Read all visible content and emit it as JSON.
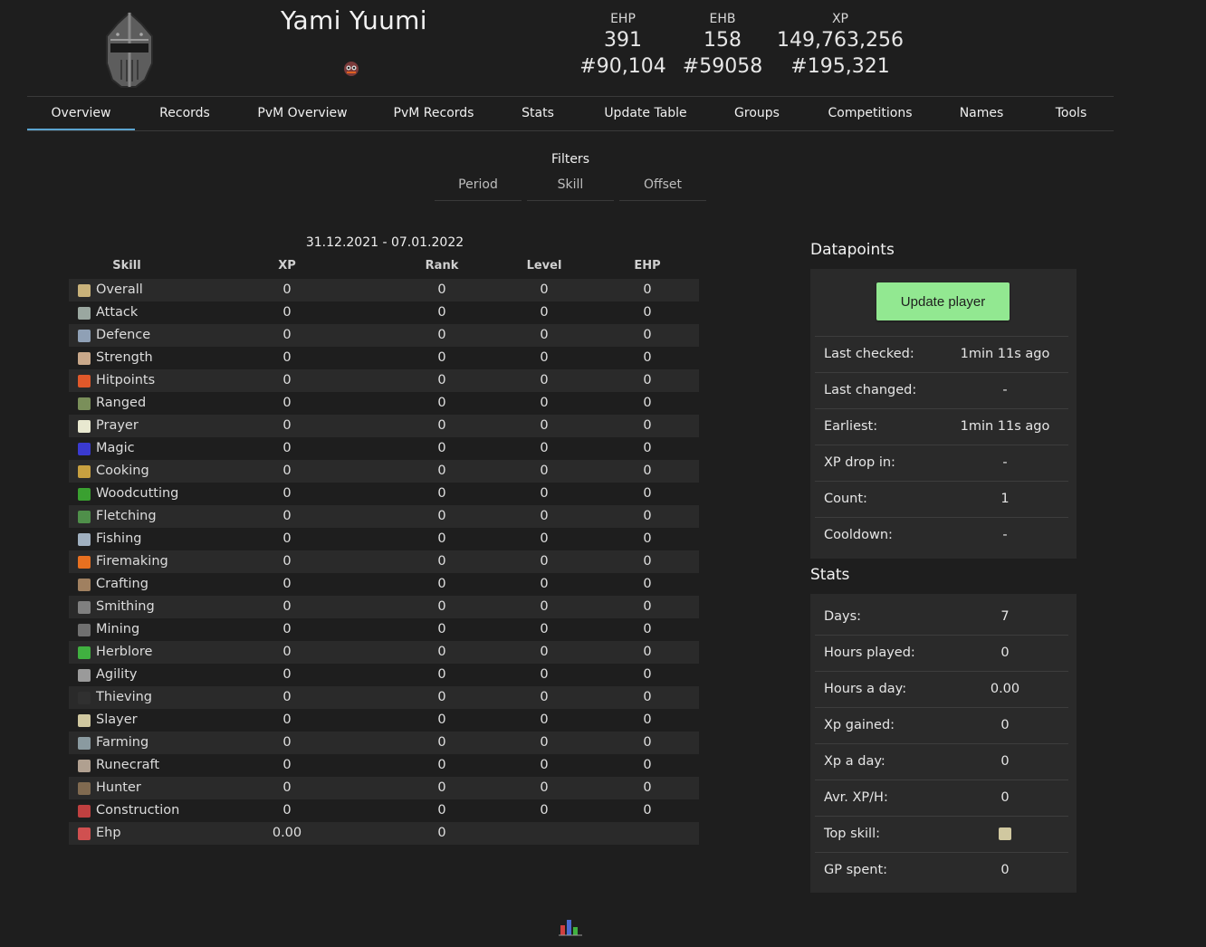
{
  "player": {
    "name": "Yami Yuumi",
    "header_stats": [
      {
        "label": "EHP",
        "value": "391",
        "rank": "#90,104"
      },
      {
        "label": "EHB",
        "value": "158",
        "rank": "#59058"
      },
      {
        "label": "XP",
        "value": "149,763,256",
        "rank": "#195,321"
      }
    ]
  },
  "nav": {
    "items": [
      {
        "label": "Overview",
        "active": true
      },
      {
        "label": "Records"
      },
      {
        "label": "PvM Overview"
      },
      {
        "label": "PvM Records"
      },
      {
        "label": "Stats"
      },
      {
        "label": "Update Table"
      },
      {
        "label": "Groups"
      },
      {
        "label": "Competitions"
      },
      {
        "label": "Names"
      },
      {
        "label": "Tools"
      }
    ]
  },
  "filters": {
    "title": "Filters",
    "tabs": [
      "Period",
      "Skill",
      "Offset"
    ]
  },
  "table": {
    "date_range": "31.12.2021 - 07.01.2022",
    "headers": [
      "Skill",
      "XP",
      "Rank",
      "Level",
      "EHP"
    ],
    "rows": [
      {
        "skill": "Overall",
        "icon": "overall-icon",
        "color": "#c9b27a",
        "xp": "0",
        "rank": "0",
        "level": "0",
        "ehp": "0"
      },
      {
        "skill": "Attack",
        "icon": "attack-icon",
        "color": "#9aa7a0",
        "xp": "0",
        "rank": "0",
        "level": "0",
        "ehp": "0"
      },
      {
        "skill": "Defence",
        "icon": "defence-icon",
        "color": "#8fa0b5",
        "xp": "0",
        "rank": "0",
        "level": "0",
        "ehp": "0"
      },
      {
        "skill": "Strength",
        "icon": "strength-icon",
        "color": "#c9a88a",
        "xp": "0",
        "rank": "0",
        "level": "0",
        "ehp": "0"
      },
      {
        "skill": "Hitpoints",
        "icon": "hitpoints-icon",
        "color": "#e0582a",
        "xp": "0",
        "rank": "0",
        "level": "0",
        "ehp": "0"
      },
      {
        "skill": "Ranged",
        "icon": "ranged-icon",
        "color": "#7a8f5a",
        "xp": "0",
        "rank": "0",
        "level": "0",
        "ehp": "0"
      },
      {
        "skill": "Prayer",
        "icon": "prayer-icon",
        "color": "#e8e8d0",
        "xp": "0",
        "rank": "0",
        "level": "0",
        "ehp": "0"
      },
      {
        "skill": "Magic",
        "icon": "magic-icon",
        "color": "#3a3ad0",
        "xp": "0",
        "rank": "0",
        "level": "0",
        "ehp": "0"
      },
      {
        "skill": "Cooking",
        "icon": "cooking-icon",
        "color": "#c8a040",
        "xp": "0",
        "rank": "0",
        "level": "0",
        "ehp": "0"
      },
      {
        "skill": "Woodcutting",
        "icon": "woodcutting-icon",
        "color": "#3aa030",
        "xp": "0",
        "rank": "0",
        "level": "0",
        "ehp": "0"
      },
      {
        "skill": "Fletching",
        "icon": "fletching-icon",
        "color": "#4f8f4a",
        "xp": "0",
        "rank": "0",
        "level": "0",
        "ehp": "0"
      },
      {
        "skill": "Fishing",
        "icon": "fishing-icon",
        "color": "#a0b0c0",
        "xp": "0",
        "rank": "0",
        "level": "0",
        "ehp": "0"
      },
      {
        "skill": "Firemaking",
        "icon": "firemaking-icon",
        "color": "#e87020",
        "xp": "0",
        "rank": "0",
        "level": "0",
        "ehp": "0"
      },
      {
        "skill": "Crafting",
        "icon": "crafting-icon",
        "color": "#a08060",
        "xp": "0",
        "rank": "0",
        "level": "0",
        "ehp": "0"
      },
      {
        "skill": "Smithing",
        "icon": "smithing-icon",
        "color": "#808080",
        "xp": "0",
        "rank": "0",
        "level": "0",
        "ehp": "0"
      },
      {
        "skill": "Mining",
        "icon": "mining-icon",
        "color": "#707070",
        "xp": "0",
        "rank": "0",
        "level": "0",
        "ehp": "0"
      },
      {
        "skill": "Herblore",
        "icon": "herblore-icon",
        "color": "#40b040",
        "xp": "0",
        "rank": "0",
        "level": "0",
        "ehp": "0"
      },
      {
        "skill": "Agility",
        "icon": "agility-icon",
        "color": "#9a9a9a",
        "xp": "0",
        "rank": "0",
        "level": "0",
        "ehp": "0"
      },
      {
        "skill": "Thieving",
        "icon": "thieving-icon",
        "color": "#303030",
        "xp": "0",
        "rank": "0",
        "level": "0",
        "ehp": "0"
      },
      {
        "skill": "Slayer",
        "icon": "slayer-icon",
        "color": "#d0c8a0",
        "xp": "0",
        "rank": "0",
        "level": "0",
        "ehp": "0"
      },
      {
        "skill": "Farming",
        "icon": "farming-icon",
        "color": "#8a9aa0",
        "xp": "0",
        "rank": "0",
        "level": "0",
        "ehp": "0"
      },
      {
        "skill": "Runecraft",
        "icon": "runecraft-icon",
        "color": "#b0a090",
        "xp": "0",
        "rank": "0",
        "level": "0",
        "ehp": "0"
      },
      {
        "skill": "Hunter",
        "icon": "hunter-icon",
        "color": "#806a50",
        "xp": "0",
        "rank": "0",
        "level": "0",
        "ehp": "0"
      },
      {
        "skill": "Construction",
        "icon": "construction-icon",
        "color": "#c04040",
        "xp": "0",
        "rank": "0",
        "level": "0",
        "ehp": "0"
      },
      {
        "skill": "Ehp",
        "icon": "ehp-icon",
        "color": "#d05050",
        "xp": "0.00",
        "rank": "0",
        "level": "",
        "ehp": ""
      }
    ]
  },
  "datapoints": {
    "title": "Datapoints",
    "update_button": "Update player",
    "rows": [
      {
        "label": "Last checked:",
        "value": "1min 11s ago"
      },
      {
        "label": "Last changed:",
        "value": "-"
      },
      {
        "label": "Earliest:",
        "value": "1min 11s ago"
      },
      {
        "label": "XP drop in:",
        "value": "-"
      },
      {
        "label": "Count:",
        "value": "1"
      },
      {
        "label": "Cooldown:",
        "value": "-"
      }
    ]
  },
  "stats": {
    "title": "Stats",
    "rows": [
      {
        "label": "Days:",
        "value": "7"
      },
      {
        "label": "Hours played:",
        "value": "0"
      },
      {
        "label": "Hours a day:",
        "value": "0.00"
      },
      {
        "label": "Xp gained:",
        "value": "0"
      },
      {
        "label": "Xp a day:",
        "value": "0"
      },
      {
        "label": "Avr. XP/H:",
        "value": "0"
      },
      {
        "label": "Top skill:",
        "value": "",
        "icon": "slayer-icon"
      },
      {
        "label": "GP spent:",
        "value": "0"
      }
    ]
  },
  "colors": {
    "background": "#1e1e1e",
    "row_alt": "#2a2a2a",
    "active_tab": "#5ba4cf",
    "update_button": "#92e891"
  }
}
